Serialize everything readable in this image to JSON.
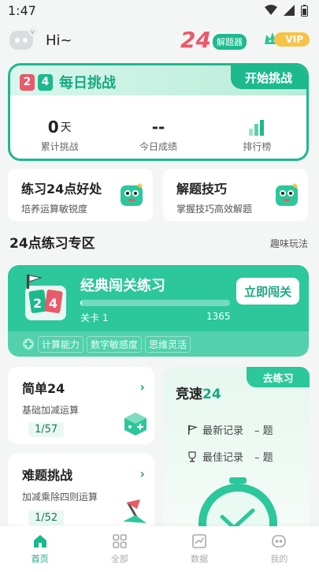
{
  "status_bar": {
    "time": "1:47"
  },
  "header": {
    "greeting": "Hi~",
    "brand_number": "24",
    "brand_tag": "解题器",
    "vip_label": "VIP"
  },
  "daily_challenge": {
    "tiles": [
      "2",
      "4"
    ],
    "title": "每日挑战",
    "start_label": "开始挑战",
    "stats": {
      "total_value": "0",
      "total_unit": "天",
      "total_label": "累计挑战",
      "today_value": "--",
      "today_label": "今日成绩",
      "ranking_label": "排行榜"
    }
  },
  "cards": {
    "benefits": {
      "title": "练习24点好处",
      "subtitle": "培养运算敏锐度"
    },
    "tips": {
      "title": "解题技巧",
      "subtitle": "掌握技巧高效解题"
    }
  },
  "section": {
    "title": "24点练习专区",
    "link": "趣味玩法"
  },
  "classic": {
    "title": "经典闯关练习",
    "level_label": "关卡 1",
    "max_level": "1365",
    "progress": 0.01,
    "button": "立即闯关",
    "chips": [
      "计算能力",
      "数字敏感度",
      "思维灵活"
    ]
  },
  "modes": {
    "simple": {
      "title": "简单24",
      "subtitle": "基础加减运算",
      "count": "1/57"
    },
    "hard": {
      "title": "难题挑战",
      "subtitle": "加减乘除四则运算",
      "count": "1/52"
    }
  },
  "speed": {
    "go_label": "去练习",
    "title_prefix": "竞速",
    "title_number": "24",
    "latest_label": "最新记录",
    "latest_value": "– 题",
    "best_label": "最佳记录",
    "best_value": "– 题"
  },
  "tabbar": {
    "home": "首页",
    "all": "全部",
    "data": "数据",
    "mine": "我的"
  },
  "colors": {
    "accent": "#1cb98d",
    "brand_red": "#e95a6a",
    "vip": "#f6c247"
  }
}
